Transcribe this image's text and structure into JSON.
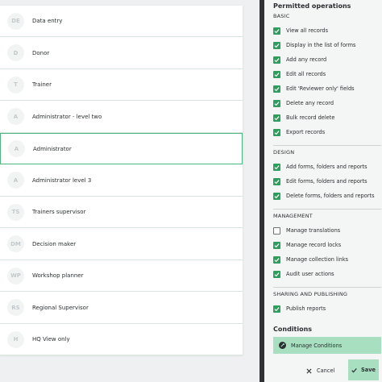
{
  "roles": [
    {
      "initials": "DE",
      "name": "Data entry",
      "selected": false
    },
    {
      "initials": "D",
      "name": "Donor",
      "selected": false
    },
    {
      "initials": "T",
      "name": "Trainer",
      "selected": false
    },
    {
      "initials": "A",
      "name": "Administrator - level two",
      "selected": false
    },
    {
      "initials": "A",
      "name": "Administrator",
      "selected": true
    },
    {
      "initials": "A",
      "name": "Administrator level 3",
      "selected": false
    },
    {
      "initials": "TS",
      "name": "Trainers supervisor",
      "selected": false
    },
    {
      "initials": "DM",
      "name": "Decision maker",
      "selected": false
    },
    {
      "initials": "WP",
      "name": "Workshop planner",
      "selected": false
    },
    {
      "initials": "RS",
      "name": "Regional Supervisor",
      "selected": false
    },
    {
      "initials": "H",
      "name": "HQ View only",
      "selected": false
    }
  ],
  "permissions": {
    "title": "Permitted operations",
    "sections": [
      {
        "label": "BASIC",
        "items": [
          {
            "label": "View all records",
            "checked": true
          },
          {
            "label": "Display in the list of forms",
            "checked": true
          },
          {
            "label": "Add any record",
            "checked": true
          },
          {
            "label": "Edit all records",
            "checked": true
          },
          {
            "label": "Edit 'Reviewer only' fields",
            "checked": true
          },
          {
            "label": "Delete any record",
            "checked": true
          },
          {
            "label": "Bulk record delete",
            "checked": true
          },
          {
            "label": "Export records",
            "checked": true
          }
        ]
      },
      {
        "label": "DESIGN",
        "items": [
          {
            "label": "Add forms, folders and reports",
            "checked": true
          },
          {
            "label": "Edit forms, folders and reports",
            "checked": true
          },
          {
            "label": "Delete forms, folders and reports",
            "checked": true
          }
        ]
      },
      {
        "label": "MANAGEMENT",
        "items": [
          {
            "label": "Manage translations",
            "checked": false
          },
          {
            "label": "Manage record locks",
            "checked": true
          },
          {
            "label": "Manage collection links",
            "checked": true
          },
          {
            "label": "Audit user actions",
            "checked": true
          }
        ]
      },
      {
        "label": "SHARING AND PUBLISHING",
        "items": [
          {
            "label": "Publish reports",
            "checked": true
          }
        ]
      }
    ]
  },
  "conditions": {
    "heading": "Conditions",
    "manage_label": "Manage Conditions"
  },
  "footer": {
    "cancel_label": "Cancel",
    "save_label": "Save"
  },
  "colors": {
    "accent_green": "#2e9d5e",
    "button_mint": "#a9dfc1",
    "selected_border": "#4fb57f",
    "dark_bar": "#2f3335"
  },
  "icons": {
    "manage_conditions": "gear-icon",
    "cancel": "close-icon",
    "save": "checkmark-icon"
  }
}
